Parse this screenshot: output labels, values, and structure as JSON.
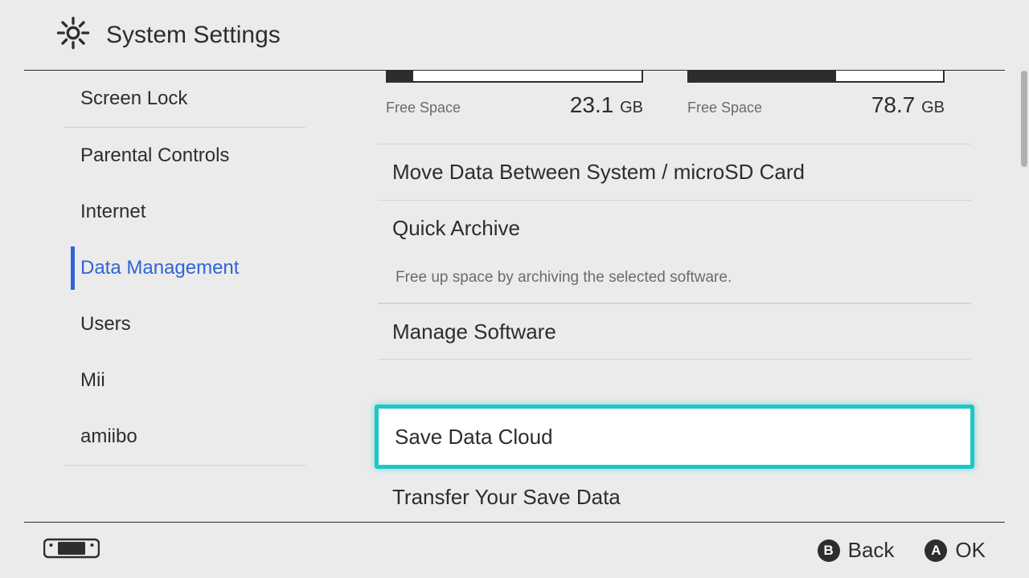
{
  "header": {
    "title": "System Settings"
  },
  "sidebar": {
    "items": [
      {
        "label": "Screen Lock",
        "active": false,
        "dividerAfter": true
      },
      {
        "label": "Parental Controls",
        "active": false
      },
      {
        "label": "Internet",
        "active": false
      },
      {
        "label": "Data Management",
        "active": true
      },
      {
        "label": "Users",
        "active": false
      },
      {
        "label": "Mii",
        "active": false
      },
      {
        "label": "amiibo",
        "active": false,
        "dividerAfter": true
      }
    ]
  },
  "storage": [
    {
      "free_label": "Free Space",
      "free_value": "23.1",
      "free_unit": "GB",
      "fill_pct": 10
    },
    {
      "free_label": "Free Space",
      "free_value": "78.7",
      "free_unit": "GB",
      "fill_pct": 58
    }
  ],
  "main": {
    "move_data": "Move Data Between System / microSD Card",
    "quick_archive": "Quick Archive",
    "quick_archive_help": "Free up space by archiving the selected software.",
    "manage_software": "Manage Software",
    "save_data_cloud": "Save Data Cloud",
    "transfer_save": "Transfer Your Save Data"
  },
  "footer": {
    "back_key": "B",
    "back_label": "Back",
    "ok_key": "A",
    "ok_label": "OK"
  }
}
